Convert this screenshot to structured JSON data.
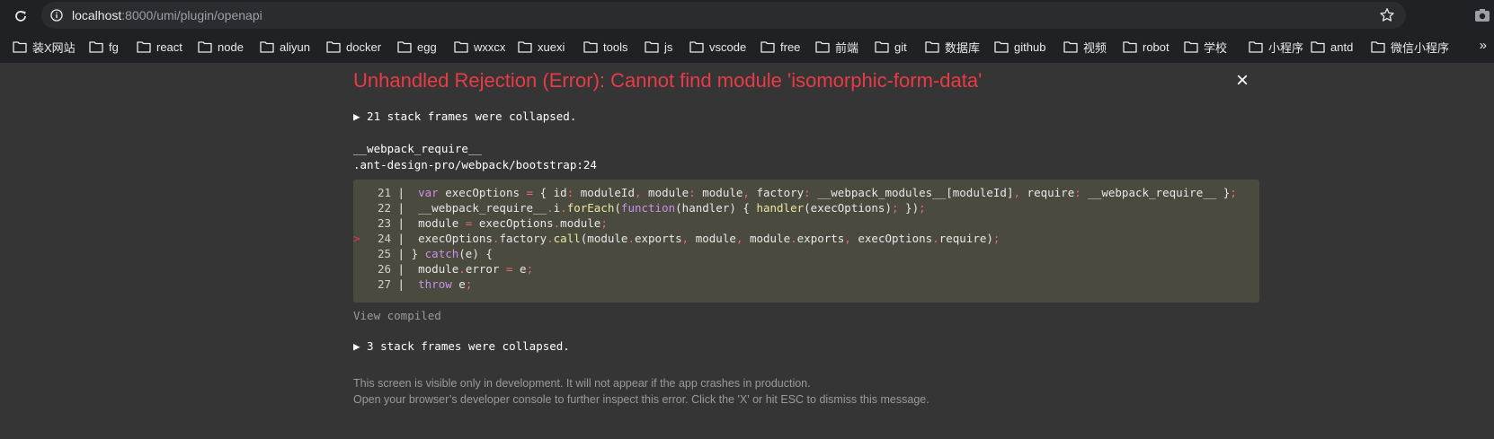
{
  "browser": {
    "url_host": "localhost",
    "url_path": ":8000/umi/plugin/openapi",
    "bookmarks": [
      "装X网站",
      "fg",
      "react",
      "node",
      "aliyun",
      "docker",
      "egg",
      "wxxcx",
      "xuexi",
      "tools",
      "js",
      "vscode",
      "free",
      "前端",
      "git",
      "数据库",
      "github",
      "视频",
      "robot",
      "学校",
      "小程序",
      "antd",
      "微信小程序"
    ],
    "more_label": "»"
  },
  "error": {
    "title": "Unhandled Rejection (Error): Cannot find module 'isomorphic-form-data'",
    "close_label": "×",
    "collapsed_top": "▶ 21 stack frames were collapsed.",
    "function_name": "__webpack_require__",
    "file_location": ".ant-design-pro/webpack/bootstrap:24",
    "code_lines": [
      {
        "num": "21",
        "marker": " ",
        "code": "  var execOptions = { id: moduleId, module: module, factory: __webpack_modules__[moduleId], require: __webpack_require__ };"
      },
      {
        "num": "22",
        "marker": " ",
        "code": "  __webpack_require__.i.forEach(function(handler) { handler(execOptions); });"
      },
      {
        "num": "23",
        "marker": " ",
        "code": "  module = execOptions.module;"
      },
      {
        "num": "24",
        "marker": ">",
        "code": "  execOptions.factory.call(module.exports, module, module.exports, execOptions.require);"
      },
      {
        "num": "25",
        "marker": " ",
        "code": " } catch(e) {"
      },
      {
        "num": "26",
        "marker": " ",
        "code": "  module.error = e;"
      },
      {
        "num": "27",
        "marker": " ",
        "code": "  throw e;"
      }
    ],
    "view_compiled": "View compiled",
    "collapsed_bottom": "▶ 3 stack frames were collapsed.",
    "footer_line1": "This screen is visible only in development. It will not appear if the app crashes in production.",
    "footer_line2": "Open your browser’s developer console to further inspect this error.  Click the 'X' or hit ESC to dismiss this message."
  }
}
